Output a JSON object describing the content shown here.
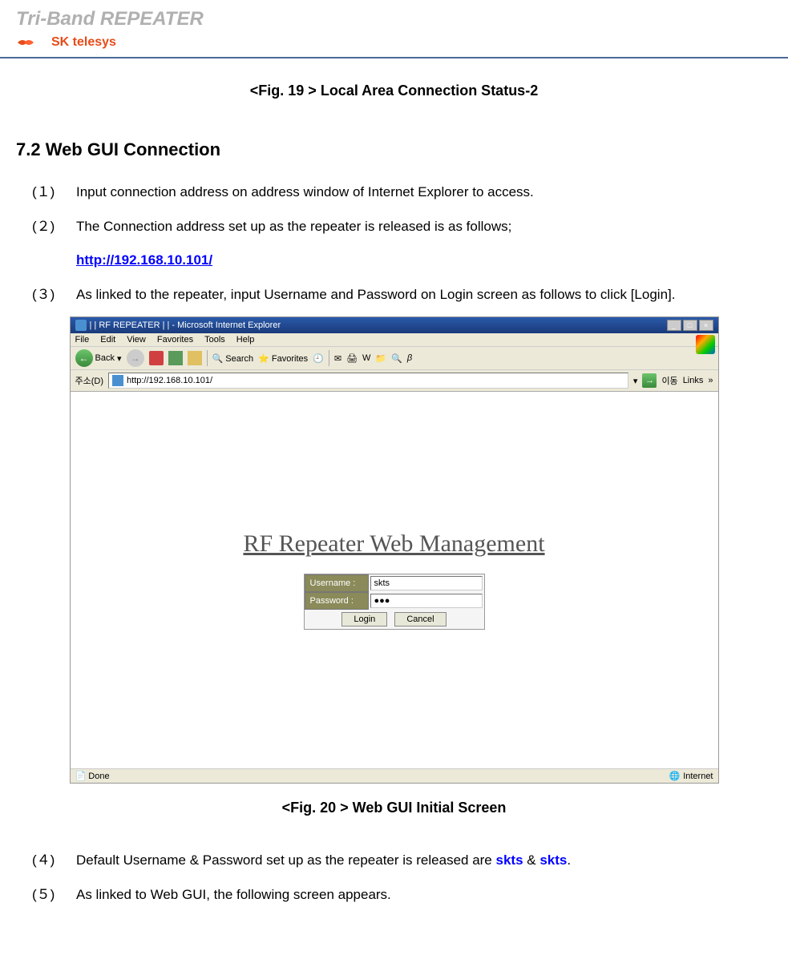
{
  "header": {
    "title": "Tri-Band REPEATER",
    "logo_text": "SK telesys"
  },
  "fig19_caption": "<Fig. 19 > Local Area Connection Status-2",
  "section": {
    "heading": "7.2  Web GUI Connection",
    "item1_num": "(１)",
    "item1_text": "Input connection address on address window of Internet Explorer to access.",
    "item2_num": "(２)",
    "item2_text": "The Connection address set up as the repeater is released is as follows;",
    "item2_link": " http://192.168.10.101/",
    "item3_num": "(３)",
    "item3_text": "As linked to the repeater, input Username and Password on Login screen as follows to click [Login].",
    "item4_num": "(４)",
    "item4_text_a": "Default Username & Password set up as the repeater is released are ",
    "item4_text_b": " & ",
    "item4_text_c": ".",
    "item4_skts": "skts",
    "item5_num": "(５)",
    "item5_text": "As linked to Web GUI, the following screen appears."
  },
  "ie": {
    "title": "| | RF REPEATER | |  - Microsoft Internet Explorer",
    "menu": {
      "file": "File",
      "edit": "Edit",
      "view": "View",
      "favorites": "Favorites",
      "tools": "Tools",
      "help": "Help"
    },
    "toolbar": {
      "back": "Back",
      "search": "Search",
      "favorites": "Favorites"
    },
    "address_label": "주소(D)",
    "address_url": "http://192.168.10.101/",
    "go_label": "이동",
    "links_label": "Links",
    "content_title": "RF Repeater Web Management",
    "login": {
      "username_label": "Username :",
      "password_label": "Password :",
      "username_value": "skts",
      "password_value": "●●●",
      "login_btn": "Login",
      "cancel_btn": "Cancel"
    },
    "status_done": "Done",
    "status_internet": "Internet"
  },
  "fig20_caption": "<Fig. 20 > Web GUI Initial Screen"
}
